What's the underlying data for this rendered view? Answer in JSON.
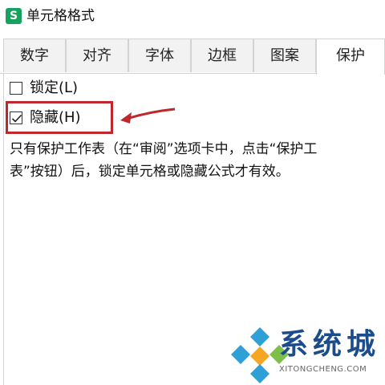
{
  "window": {
    "app_icon_letter": "S",
    "title": "单元格格式"
  },
  "tabs": [
    {
      "label": "数字"
    },
    {
      "label": "对齐"
    },
    {
      "label": "字体"
    },
    {
      "label": "边框"
    },
    {
      "label": "图案"
    },
    {
      "label": "保护",
      "active": true
    }
  ],
  "protection": {
    "lock": {
      "label": "锁定(L)",
      "checked": false
    },
    "hidden": {
      "label": "隐藏(H)",
      "checked": true
    },
    "description": "只有保护工作表（在“审阅”选项卡中，点击“保护工\n表”按钮）后，锁定单元格或隐藏公式才有效。"
  },
  "annotation": {
    "color": "#c0272d"
  },
  "watermark": {
    "text": "系统城",
    "subtext": "XITONGCHENG.COM"
  }
}
